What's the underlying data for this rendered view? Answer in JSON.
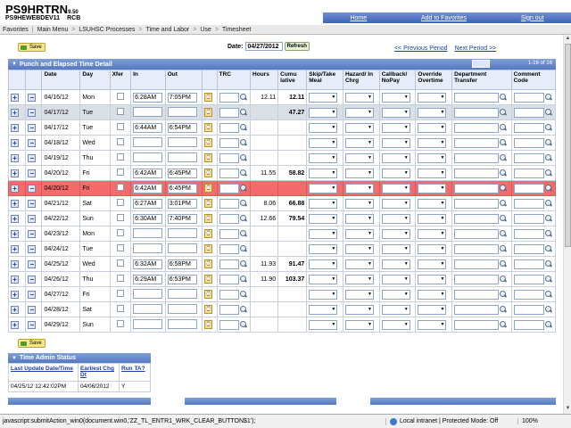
{
  "header": {
    "app_name": "PS9HRTRN",
    "version": "9.50",
    "server": "PS9HEWEBDEV11",
    "user": "RCB"
  },
  "toplinks": [
    "Home",
    "Add to Favorites",
    "Sign out"
  ],
  "nav": [
    "Favorites",
    "Main Menu",
    "LSUHSC Processes",
    "Time and Labor",
    "Use",
    "Timesheet"
  ],
  "save_label": "Save",
  "date_label": "Date:",
  "date_value": "04/27/2012",
  "refresh_label": "Refresh",
  "prev_period": "<< Previous Period",
  "next_period": "Next Period >>",
  "grid_title": "Punch and Elapsed Time Detail",
  "grid_page": "1-16 of 16",
  "columns": [
    "Date",
    "Day",
    "Xfer",
    "In",
    "Out",
    "TRC",
    "Hours",
    "Cumu lative",
    "Skip/Take Meal",
    "Hazard/ In Chrg",
    "Callback/ NoPay",
    "Override Overtime",
    "Department Transfer",
    "Comment Code"
  ],
  "rows": [
    {
      "date": "04/16/12",
      "day": "Mon",
      "in": "6:28AM",
      "out": "7:05PM",
      "hours": "12.11",
      "cum": "12.11",
      "style": ""
    },
    {
      "date": "04/17/12",
      "day": "Tue",
      "in": "",
      "out": "",
      "hours": "",
      "cum": "47.27",
      "style": "gy"
    },
    {
      "date": "04/17/12",
      "day": "Tue",
      "in": "6:44AM",
      "out": "6:54PM",
      "hours": "",
      "cum": "",
      "style": ""
    },
    {
      "date": "04/18/12",
      "day": "Wed",
      "in": "",
      "out": "",
      "hours": "",
      "cum": "",
      "style": ""
    },
    {
      "date": "04/19/12",
      "day": "Thu",
      "in": "",
      "out": "",
      "hours": "",
      "cum": "",
      "style": ""
    },
    {
      "date": "04/20/12",
      "day": "Fri",
      "in": "6:42AM",
      "out": "6:45PM",
      "hours": "11.55",
      "cum": "58.82",
      "style": ""
    },
    {
      "date": "04/20/12",
      "day": "Fri",
      "in": "6:42AM",
      "out": "6:45PM",
      "hours": "",
      "cum": "",
      "style": "hl"
    },
    {
      "date": "04/21/12",
      "day": "Sat",
      "in": "6:27AM",
      "out": "3:01PM",
      "hours": "8.06",
      "cum": "66.88",
      "style": ""
    },
    {
      "date": "04/22/12",
      "day": "Sun",
      "in": "6:30AM",
      "out": "7:40PM",
      "hours": "12.66",
      "cum": "79.54",
      "style": ""
    },
    {
      "date": "04/23/12",
      "day": "Mon",
      "in": "",
      "out": "",
      "hours": "",
      "cum": "",
      "style": ""
    },
    {
      "date": "04/24/12",
      "day": "Tue",
      "in": "",
      "out": "",
      "hours": "",
      "cum": "",
      "style": ""
    },
    {
      "date": "04/25/12",
      "day": "Wed",
      "in": "6:32AM",
      "out": "6:58PM",
      "hours": "11.93",
      "cum": "91.47",
      "style": ""
    },
    {
      "date": "04/26/12",
      "day": "Thu",
      "in": "6:29AM",
      "out": "6:53PM",
      "hours": "11.90",
      "cum": "103.37",
      "style": ""
    },
    {
      "date": "04/27/12",
      "day": "Fri",
      "in": "",
      "out": "",
      "hours": "",
      "cum": "",
      "style": ""
    },
    {
      "date": "04/28/12",
      "day": "Sat",
      "in": "",
      "out": "",
      "hours": "",
      "cum": "",
      "style": ""
    },
    {
      "date": "04/29/12",
      "day": "Sun",
      "in": "",
      "out": "",
      "hours": "",
      "cum": "",
      "style": ""
    }
  ],
  "tas": {
    "title": "Time Admin Status",
    "h1": "Last Update Date/Time",
    "h2": "Earliest Chg Dt",
    "h3": "Run TA?",
    "v1": "04/25/12 12:42:02PM",
    "v2": "04/06/2012",
    "v3": "Y"
  },
  "status": {
    "text": "javascript:submitAction_win0(document.win0,'ZZ_TL_ENTR1_WRK_CLEAR_BUTTON$1');",
    "zone": "Local intranet | Protected Mode: Off",
    "zoom": "100%"
  }
}
